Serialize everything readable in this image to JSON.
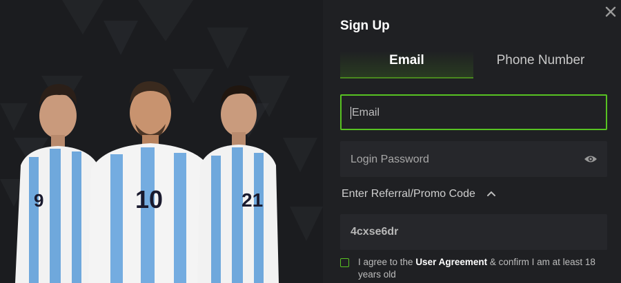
{
  "hero": {
    "players": [
      {
        "number": "9"
      },
      {
        "number": "10"
      },
      {
        "number": "21"
      }
    ]
  },
  "signup": {
    "title": "Sign Up",
    "tabs": [
      {
        "label": "Email",
        "active": true
      },
      {
        "label": "Phone Number",
        "active": false
      }
    ],
    "email_placeholder": "Email",
    "password_placeholder": "Login Password",
    "referral_label": "Enter Referral/Promo Code",
    "promo_code": "4cxse6dr",
    "agreement": {
      "prefix": "I agree to the ",
      "link": "User Agreement",
      "suffix": " & confirm I am at least 18 years old"
    },
    "icons": {
      "close": "close-icon",
      "eye": "eye-icon",
      "chevron": "chevron-up-icon"
    },
    "colors": {
      "accent": "#58c322",
      "background": "#1f2023"
    }
  }
}
